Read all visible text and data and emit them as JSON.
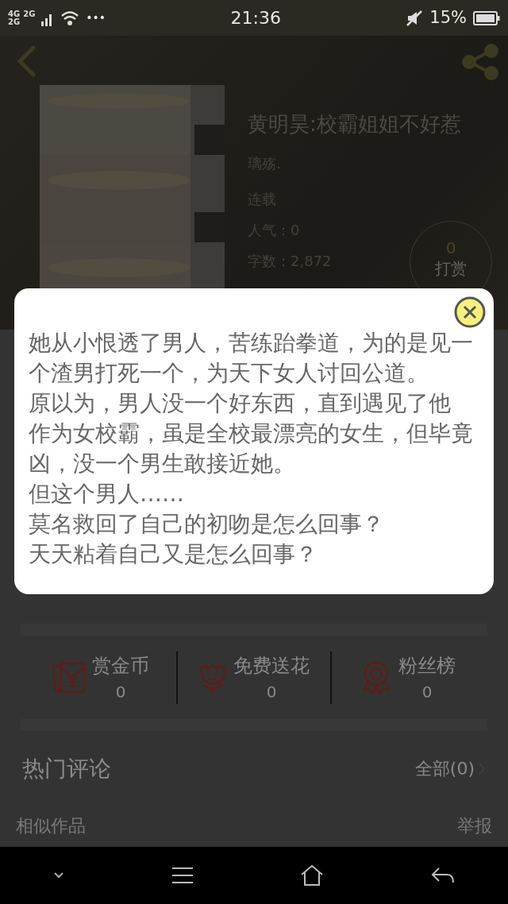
{
  "status_bar": {
    "network_labels": [
      "4G",
      "2G",
      "2G"
    ],
    "more": "•••",
    "time": "21:36",
    "battery": "15%"
  },
  "book": {
    "title": "黄明昊:校霸姐姐不好惹",
    "author": "璃殇.",
    "status": "连载",
    "stats": [
      {
        "label": "人气：",
        "value": "0"
      },
      {
        "label": "字数：",
        "value": "2,872"
      }
    ],
    "reward": {
      "count": "0",
      "label": "打赏"
    }
  },
  "synopsis": {
    "paragraphs": [
      "她从小恨透了男人，苦练跆拳道，为的是见一个渣男打死一个，为天下女人讨回公道。",
      "原以为，男人没一个好东西，直到遇见了他",
      "作为女校霸，虽是全校最漂亮的女生，但毕竟凶，没一个男生敢接近她。",
      "但这个男人……",
      "莫名救回了自己的初吻是怎么回事？",
      "天天粘着自己又是怎么回事？"
    ]
  },
  "gifts": [
    {
      "kind": "coin",
      "label": "赏金币",
      "count": "0"
    },
    {
      "kind": "flower",
      "label": "免费送花",
      "count": "0"
    },
    {
      "kind": "fans",
      "label": "粉丝榜",
      "count": "0"
    }
  ],
  "comments": {
    "title": "热门评论",
    "all": "全部(0)"
  },
  "footer": {
    "similar": "相似作品",
    "report": "举报"
  }
}
